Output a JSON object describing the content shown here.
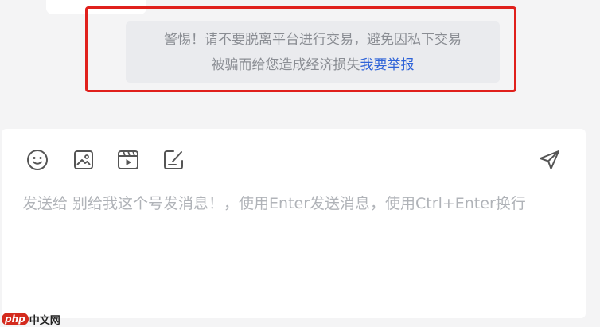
{
  "warning": {
    "line1": "警惕！请不要脱离平台进行交易，避免因私下交易",
    "line2": "被骗而给您造成经济损失",
    "report_link": "我要举报"
  },
  "composer": {
    "placeholder": "发送给 别给我这个号发消息！，使用Enter发送消息，使用Ctrl+Enter换行",
    "toolbar": [
      "emoji-icon",
      "image-icon",
      "video-icon",
      "edit-note-icon"
    ],
    "send_icon": "send-icon"
  },
  "watermark": {
    "brand": "php",
    "site": "中文网"
  },
  "colors": {
    "highlight_border": "#e0201c",
    "link": "#2e63d8",
    "warning_bg": "#eaebee"
  }
}
